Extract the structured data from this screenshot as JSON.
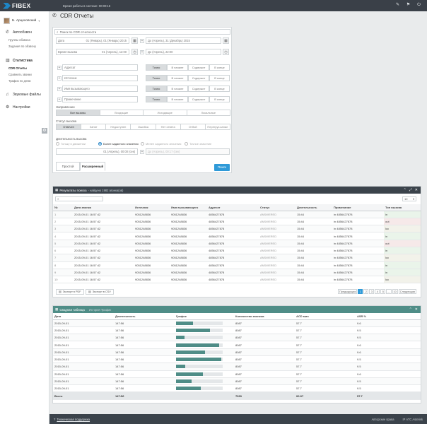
{
  "topbar": {
    "logo": "FIBEX",
    "status": "Время работы в системе: 00:00:16",
    "icons": [
      "wrench-icon",
      "flag-icon",
      "power-icon"
    ]
  },
  "sidebar": {
    "user": "Б. Арцеховский",
    "sections": [
      {
        "label": "Автообзвон",
        "icon": "phone-icon",
        "items": [
          "Группы обзвона",
          "Задания по обзвону"
        ]
      },
      {
        "label": "Статистика",
        "icon": "chart-icon",
        "items": [
          "CDR Отчеты",
          "Сравнить звонки",
          "Трафик по дням"
        ]
      },
      {
        "label": "Звуковые файлы",
        "icon": "music-icon",
        "items": []
      },
      {
        "label": "Настройки",
        "icon": "gear-icon",
        "items": []
      }
    ]
  },
  "page": {
    "title": "CDR Отчеты"
  },
  "filters": {
    "search_placeholder": "Поиск по CDR отчетности",
    "date_from_label": "Дата",
    "date_from_value": "01 (Январь), 01 (Январь) 2015",
    "date_to_value": "До (Апрель), 31 (Декабрь) 2015",
    "time_from_label": "Время вызова",
    "time_from_value": "01 (Апрель), 12:00",
    "time_to_value": "До (Апрель), 22:00",
    "fields": [
      "Адресат",
      "Источник",
      "Имя вызывающего",
      "Примечание"
    ],
    "match_opts": [
      "Точно",
      "В начале",
      "Содержит",
      "В конце"
    ],
    "direction_label": "Направление",
    "direction_opts": [
      "Все вызовы",
      "Входящие",
      "Исходящие",
      "Локальные"
    ],
    "status_label": "Статус вызова",
    "status_opts": [
      "Отвечен",
      "Занят",
      "Недоступен",
      "Ошибка",
      "Нет ответа",
      "Отбой",
      "Перегруз канал"
    ],
    "duration_label": "Длительность вызова",
    "duration_opts": [
      "Тоньку в движении",
      "Более заданного значения",
      "Менее заданного значения",
      "Точное значение"
    ],
    "duration_value": "01 (Апрель), 00:00 (сек)",
    "duration_to": "До (Апрель), 00:17 (сек)",
    "tabs": [
      "Простой",
      "Расширенный"
    ],
    "search_button": "Поиск"
  },
  "results": {
    "title": "Результаты поиска",
    "subtitle": "- найдено 1982 звонка(ов)",
    "page_size": "10",
    "columns": [
      "№",
      "Дата звонка",
      "Источник",
      "Имя вызывающего",
      "Адресат",
      "Статус",
      "Длительность",
      "Примечание",
      "Тип вызова"
    ],
    "rows": [
      [
        "1",
        "2015-09-01 16:57:42",
        "9051248836",
        "9051248836",
        "4856427878",
        "ANSWERED",
        "15:44",
        "in 4856427878",
        "in"
      ],
      [
        "2",
        "2015-09-01 16:57:42",
        "9051248836",
        "9051248836",
        "4856427878",
        "ANSWERED",
        "15:44",
        "in 4856427878",
        "out"
      ],
      [
        "3",
        "2015-09-01 16:57:42",
        "9051248836",
        "9051248836",
        "4856427878",
        "ANSWERED",
        "15:44",
        "in 4856427878",
        "loc"
      ],
      [
        "4",
        "2015-09-01 16:57:42",
        "9051248836",
        "9051248836",
        "4856427878",
        "ANSWERED",
        "15:44",
        "in 4856427878",
        "in"
      ],
      [
        "5",
        "2015-09-01 16:57:42",
        "9051248836",
        "9051248836",
        "4856427878",
        "ANSWERED",
        "15:44",
        "in 4856427878",
        "out"
      ],
      [
        "6",
        "2015-09-01 16:57:42",
        "9051248836",
        "9051248836",
        "4856427878",
        "ANSWERED",
        "15:44",
        "in 4856427878",
        "in"
      ],
      [
        "7",
        "2015-09-01 16:57:42",
        "9051248836",
        "9051248836",
        "4856427878",
        "ANSWERED",
        "15:44",
        "in 4856427878",
        "loc"
      ],
      [
        "8",
        "2015-09-01 16:57:42",
        "9051248836",
        "9051248836",
        "4856427878",
        "ANSWERED",
        "15:44",
        "in 4856427878",
        "in"
      ],
      [
        "9",
        "2015-09-01 16:57:42",
        "9051248836",
        "9051248836",
        "4856427878",
        "ANSWERED",
        "15:44",
        "in 4856427878",
        "in"
      ],
      [
        "10",
        "2015-09-01 16:57:42",
        "9051248836",
        "9051248836",
        "4856427878",
        "ANSWERED",
        "15:44",
        "in 4856427878",
        "loc"
      ]
    ],
    "export_pdf": "Экспорт в PDF",
    "export_csv": "Экспорт в CSV",
    "pager": [
      "Предыдущая",
      "1",
      "2",
      "3",
      "4",
      "5",
      "...",
      "10",
      "Следующая"
    ]
  },
  "summary": {
    "title": "Сводная таблица",
    "tab2": "История Трафик",
    "columns": [
      "Дата",
      "Длительность",
      "График",
      "Количество звонков",
      "ACD мин",
      "ASR %"
    ],
    "rows": [
      {
        "date": "2015-09-01",
        "dur": "147:56",
        "bar": 0.36,
        "calls": "8087",
        "acd": "57.7",
        "asr": "9.6"
      },
      {
        "date": "2015-09-01",
        "dur": "147:56",
        "bar": 0.73,
        "calls": "8087",
        "acd": "57.7",
        "asr": "9.5"
      },
      {
        "date": "2015-09-01",
        "dur": "147:56",
        "bar": 0.18,
        "calls": "8087",
        "acd": "57.7",
        "asr": "9.5"
      },
      {
        "date": "2015-09-01",
        "dur": "147:56",
        "bar": 0.92,
        "calls": "8087",
        "acd": "57.7",
        "asr": "9.6"
      },
      {
        "date": "2015-09-01",
        "dur": "147:56",
        "bar": 0.62,
        "calls": "8087",
        "acd": "57.7",
        "asr": "9.6"
      },
      {
        "date": "2015-09-01",
        "dur": "147:56",
        "bar": 0.97,
        "calls": "8087",
        "acd": "57.7",
        "asr": "9.5"
      },
      {
        "date": "2015-09-01",
        "dur": "147:56",
        "bar": 0.2,
        "calls": "8087",
        "acd": "57.7",
        "asr": "9.5"
      },
      {
        "date": "2015-09-01",
        "dur": "147:56",
        "bar": 0.58,
        "calls": "8087",
        "acd": "57.7",
        "asr": "9.6"
      },
      {
        "date": "2015-09-01",
        "dur": "147:56",
        "bar": 0.33,
        "calls": "8087",
        "acd": "57.7",
        "asr": "9.5"
      },
      {
        "date": "2015-09-01",
        "dur": "147:56",
        "bar": 0.53,
        "calls": "8087",
        "acd": "57.7",
        "asr": "9.5"
      }
    ],
    "totals": {
      "label": "Всего",
      "dur": "147:56",
      "calls": "7933",
      "acd": "00:07",
      "asr": "57.7"
    }
  },
  "footer": {
    "support": "Техническая поддержка",
    "right1": "Авторские права",
    "right2": "IP АТС Asterisk"
  }
}
